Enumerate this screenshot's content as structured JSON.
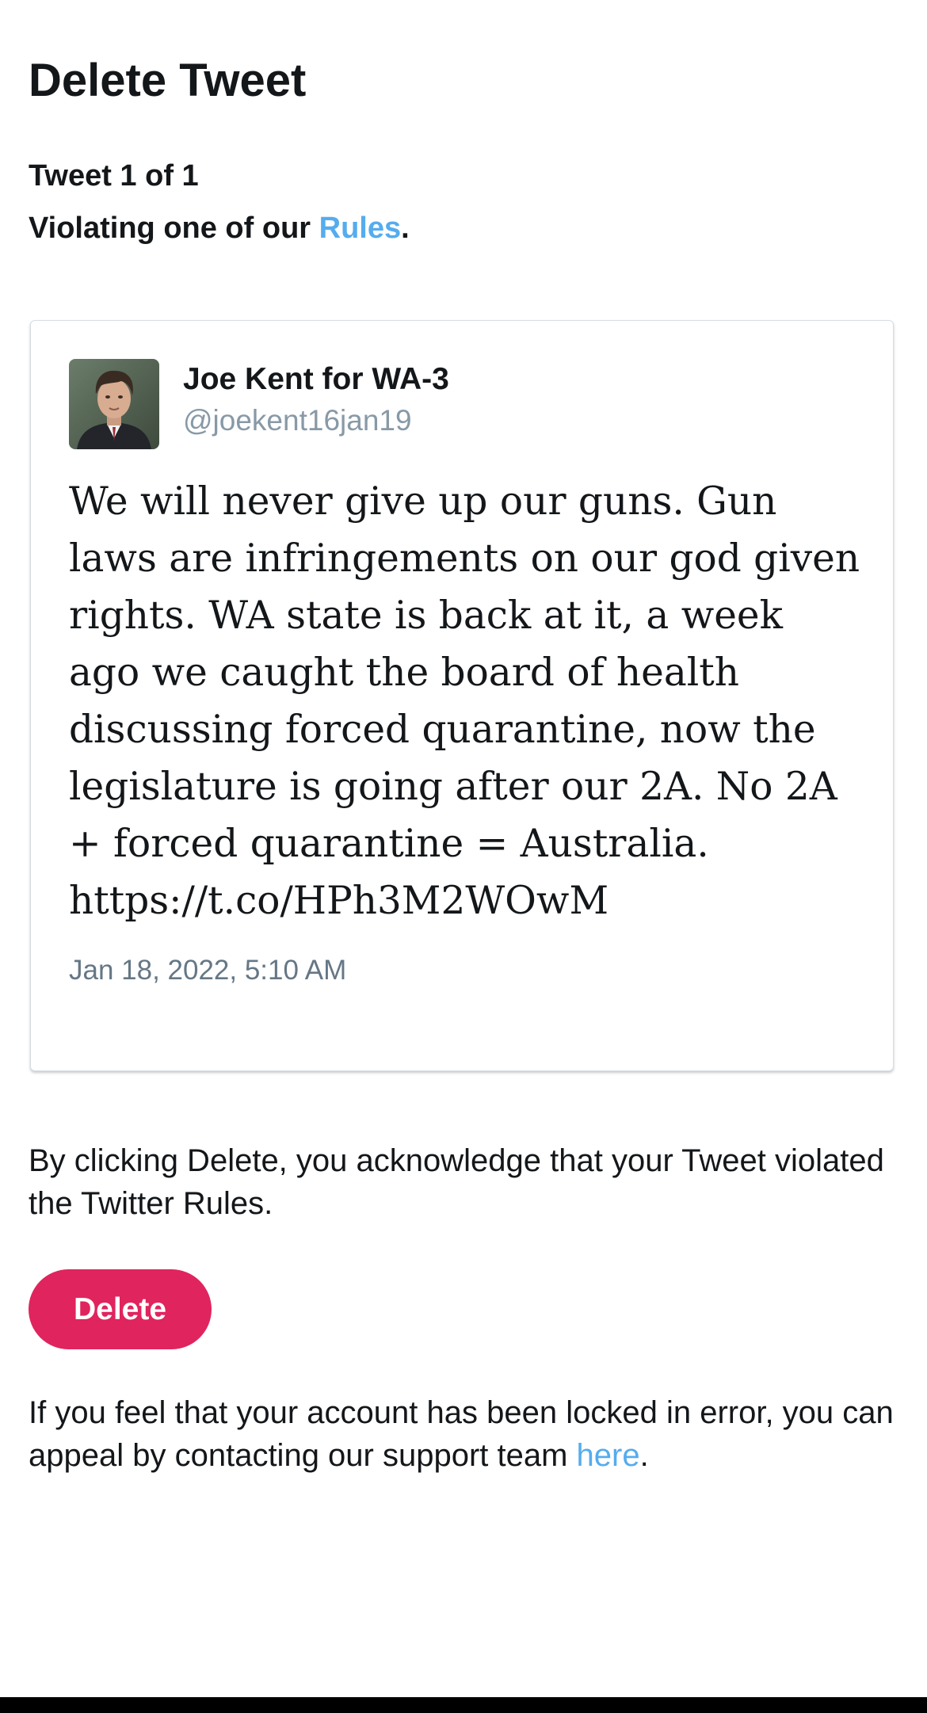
{
  "header": {
    "title": "Delete Tweet",
    "counter": "Tweet 1 of 1",
    "reason_prefix": "Violating one of our ",
    "reason_link": "Rules",
    "reason_suffix": "."
  },
  "tweet": {
    "author_name": "Joe Kent for WA-3",
    "author_handle": "@joekent16jan19",
    "text": "We will never give up our guns. Gun laws are infringements on our god given rights. WA state is back at it, a week ago we caught the board of health discussing forced quarantine, now the legislature is going after our 2A. No 2A + forced quarantine = Australia. https://t.co/HPh3M2WOwM",
    "date": "Jan 18, 2022, 5:10 AM"
  },
  "acknowledgement": "By clicking Delete, you acknowledge that your Tweet violated the Twitter Rules.",
  "delete_button": {
    "label": "Delete"
  },
  "appeal": {
    "prefix": "If you feel that your account has been locked in error, you can appeal by contacting our support team ",
    "link": "here",
    "suffix": "."
  },
  "colors": {
    "link": "#55acee",
    "delete_button": "#e0245e",
    "handle": "#8899a6"
  }
}
